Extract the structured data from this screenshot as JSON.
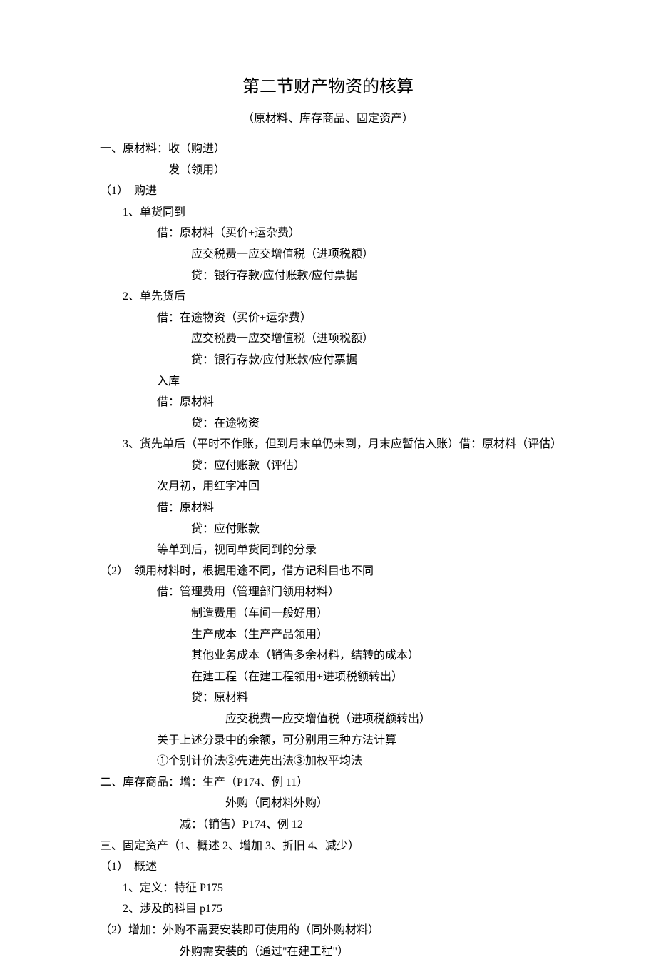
{
  "title": "第二节财产物资的核算",
  "subtitle": "（原材料、库存商品、固定资产）",
  "lines": [
    {
      "cls": "l0",
      "text": "一、原材料：收（购进）"
    },
    {
      "cls": "l-indent2",
      "text": "发（领用）"
    },
    {
      "cls": "l0",
      "text": "（1）　购进"
    },
    {
      "cls": "l1",
      "text": "1、单货同到"
    },
    {
      "cls": "l2",
      "text": "借：原材料（买价+运杂费）"
    },
    {
      "cls": "l3",
      "text": "应交税费一应交增值税（进项税额）"
    },
    {
      "cls": "l3",
      "text": "贷：银行存款/应付账款/应付票据"
    },
    {
      "cls": "l1",
      "text": "2、单先货后"
    },
    {
      "cls": "l2",
      "text": "借：在途物资（买价+运杂费）"
    },
    {
      "cls": "l3",
      "text": "应交税费一应交增值税（进项税额）"
    },
    {
      "cls": "l3",
      "text": "贷：银行存款/应付账款/应付票据"
    },
    {
      "cls": "l2",
      "text": "入库"
    },
    {
      "cls": "l2",
      "text": "借：原材料"
    },
    {
      "cls": "l3",
      "text": "贷：在途物资"
    },
    {
      "cls": "l1",
      "text": "3、货先单后（平时不作账，但到月末单仍未到，月末应暂估入账）借：原材料（评估）"
    },
    {
      "cls": "l3",
      "text": "贷：应付账款（评估）"
    },
    {
      "cls": "l2",
      "text": "次月初，用红字冲回"
    },
    {
      "cls": "l2",
      "text": "借：原材料"
    },
    {
      "cls": "l3",
      "text": "贷：应付账款"
    },
    {
      "cls": "l2",
      "text": "等单到后，视同单货同到的分录"
    },
    {
      "cls": "l0",
      "text": "（2）　领用材料时，根据用途不同，借方记科目也不同"
    },
    {
      "cls": "l2",
      "text": "借：管理费用（管理部门领用材料）"
    },
    {
      "cls": "l3",
      "text": "制造费用（车间一般好用）"
    },
    {
      "cls": "l3",
      "text": "生产成本（生产产品领用）"
    },
    {
      "cls": "l3",
      "text": "其他业务成本（销售多余材料，结转的成本）"
    },
    {
      "cls": "l3",
      "text": "在建工程（在建工程领用+进项税额转出）"
    },
    {
      "cls": "l3",
      "text": "贷：原材料"
    },
    {
      "cls": "l4",
      "text": "应交税费一应交增值税（进项税额转出）"
    },
    {
      "cls": "l2",
      "text": "关于上述分录中的余额，可分别用三种方法计算"
    },
    {
      "cls": "l2",
      "text": "①个别计价法②先进先出法③加权平均法"
    },
    {
      "cls": "l0",
      "text": "二、库存商品：增：生产（P174、例 11）"
    },
    {
      "cls": "l4",
      "text": "外购（同材料外购）"
    },
    {
      "cls": "l-credit",
      "text": "减：（销售）P174、例 12"
    },
    {
      "cls": "l0",
      "text": "三、固定资产（1、概述 2、增加 3、折旧 4、减少）"
    },
    {
      "cls": "l0",
      "text": "（1）　概述"
    },
    {
      "cls": "l1",
      "text": "1、定义：特征 P175"
    },
    {
      "cls": "l1",
      "text": "2、涉及的科目 p175"
    },
    {
      "cls": "l0",
      "text": "（2）增加：外购不需要安装即可使用的（同外购材料）"
    },
    {
      "cls": "l-credit",
      "text": "外购需安装的（通过\"在建工程\"）"
    }
  ]
}
